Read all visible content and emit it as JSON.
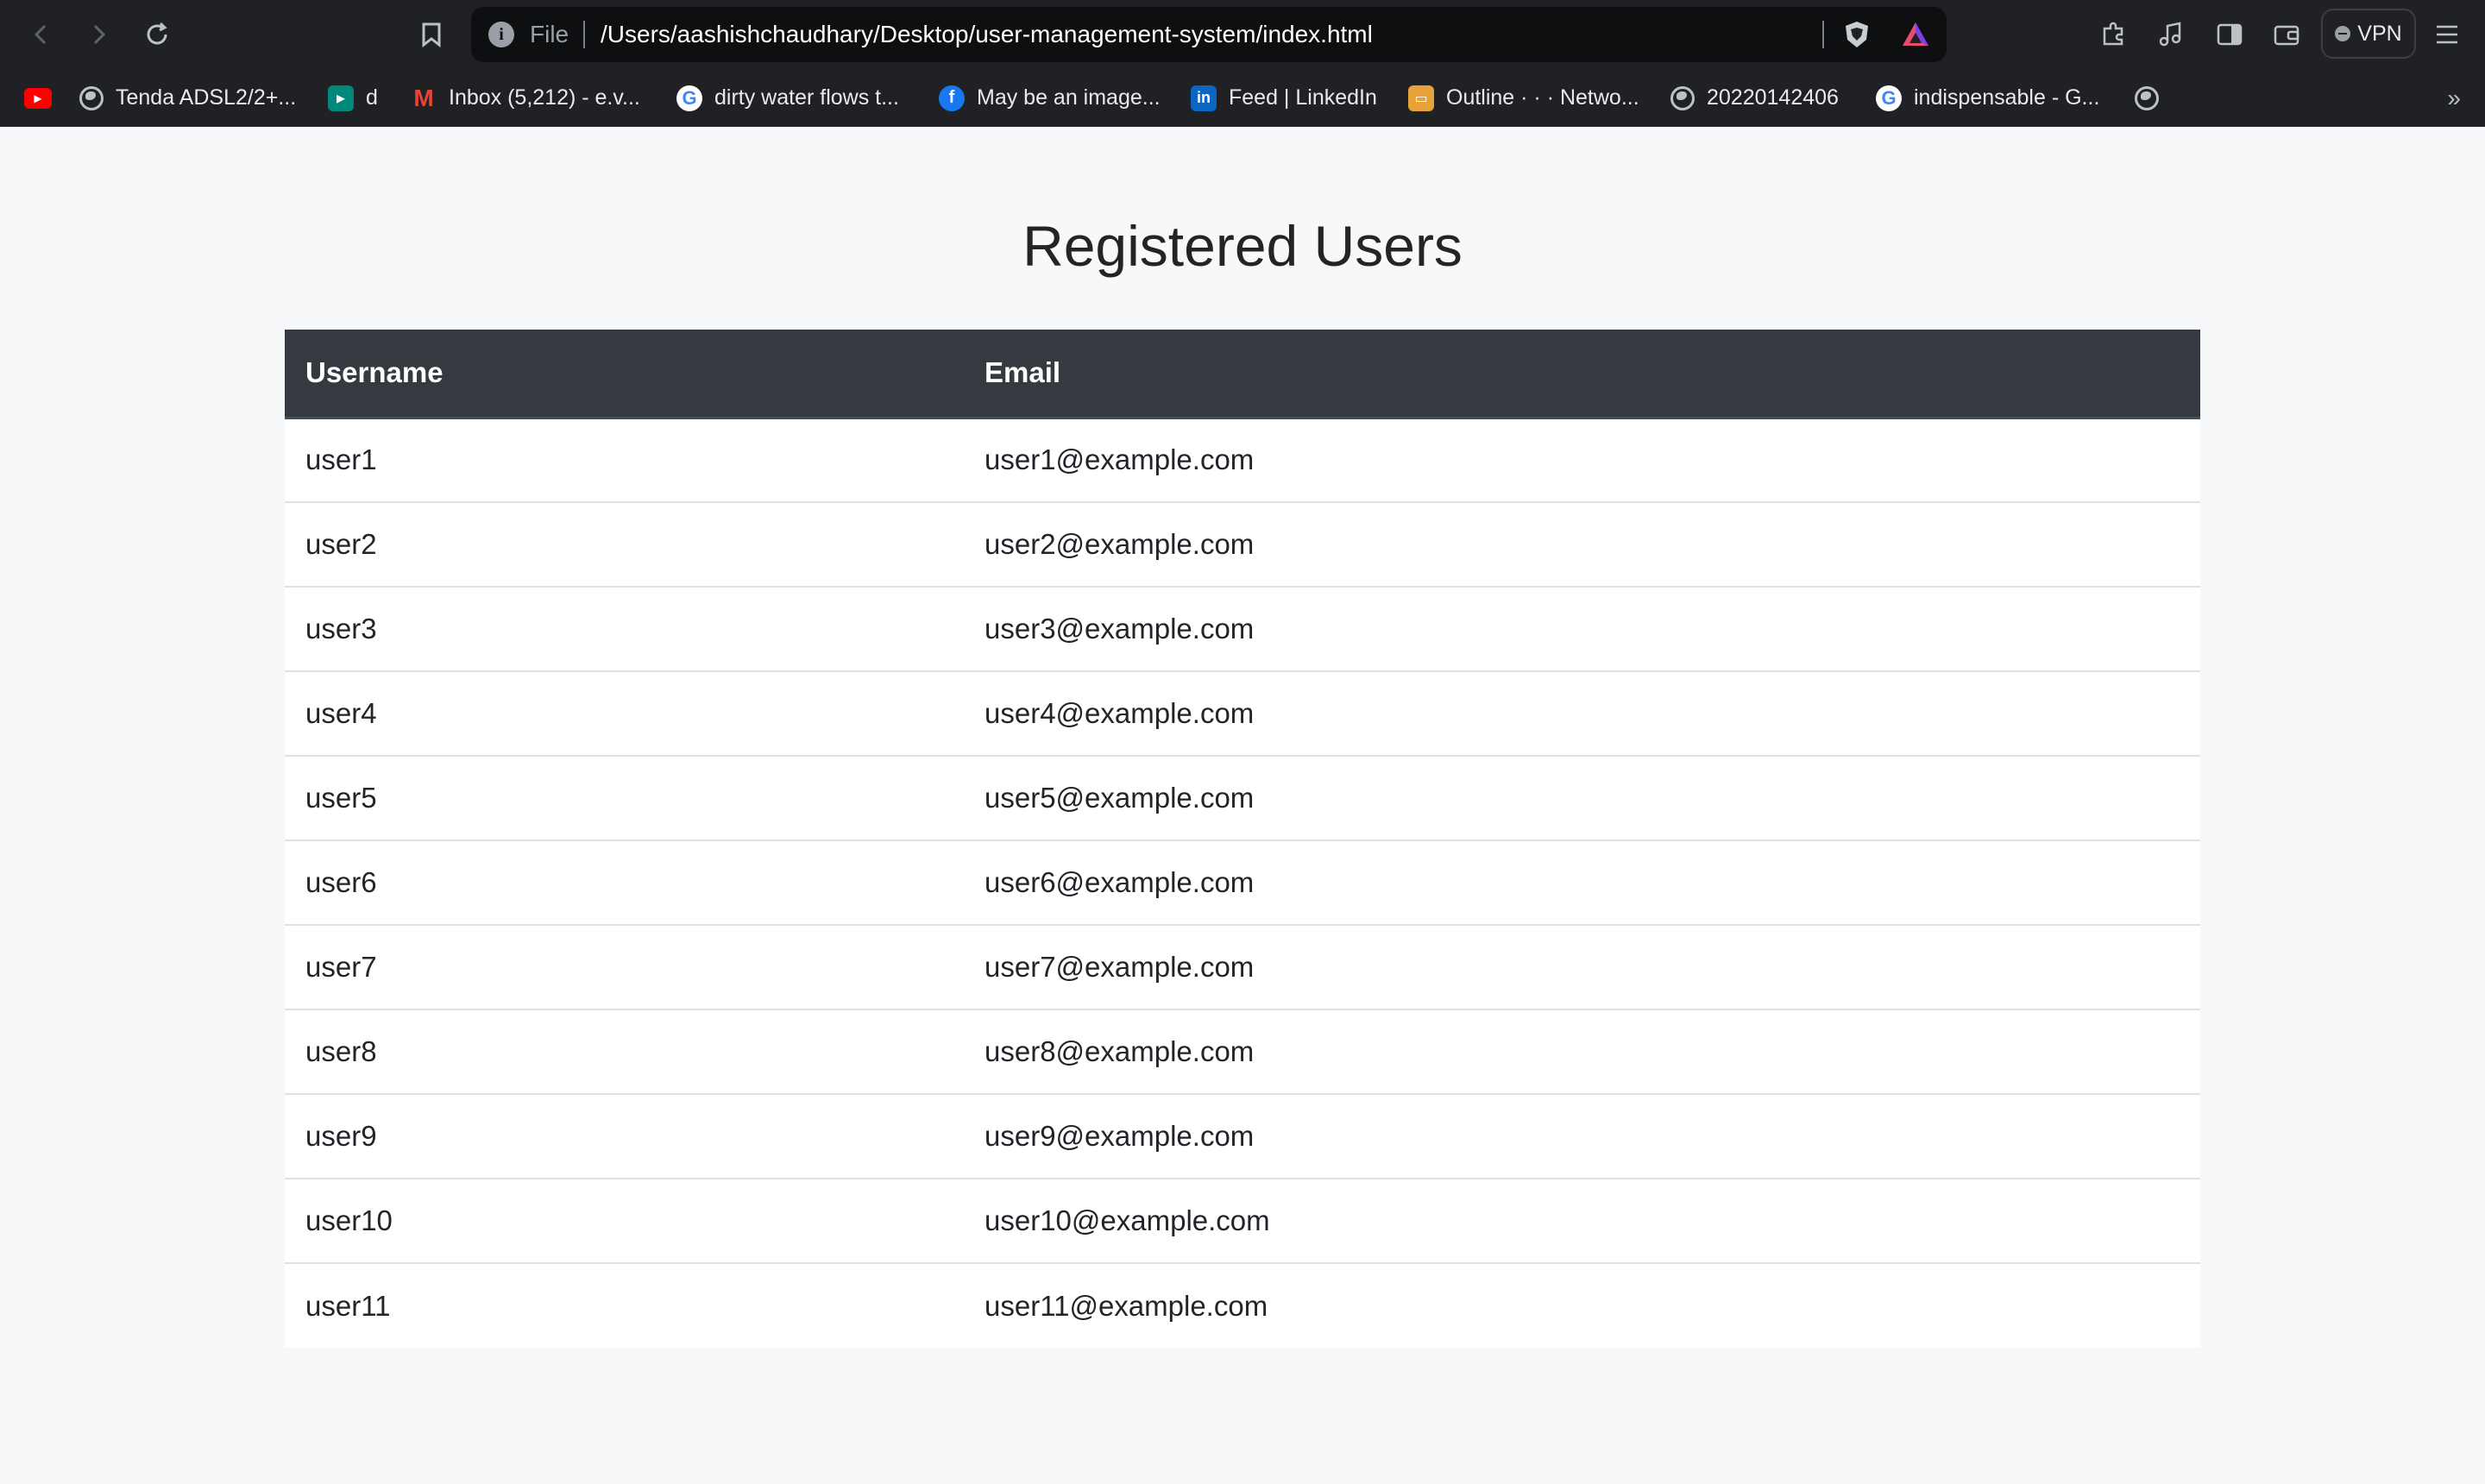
{
  "browser": {
    "address_scheme": "File",
    "address_path": "/Users/aashishchaudhary/Desktop/user-management-system/index.html",
    "vpn_label": "VPN",
    "bookmarks": [
      {
        "label": "",
        "icon": "youtube-icon"
      },
      {
        "label": "Tenda ADSL2/2+...",
        "icon": "globe-icon"
      },
      {
        "label": "d",
        "icon": "google-meet-icon"
      },
      {
        "label": "Inbox (5,212) - e.v...",
        "icon": "gmail-icon"
      },
      {
        "label": "dirty water flows t...",
        "icon": "google-icon"
      },
      {
        "label": "May be an image...",
        "icon": "facebook-icon"
      },
      {
        "label": "Feed | LinkedIn",
        "icon": "linkedin-icon"
      },
      {
        "label": "Outline · · · Netwo...",
        "icon": "slides-icon"
      },
      {
        "label": "20220142406",
        "icon": "globe-icon"
      },
      {
        "label": "indispensable - G...",
        "icon": "google-icon"
      },
      {
        "label": "",
        "icon": "globe-icon"
      }
    ],
    "more_bookmarks": "»"
  },
  "page": {
    "title": "Registered Users",
    "table": {
      "headers": {
        "username": "Username",
        "email": "Email"
      },
      "rows": [
        {
          "username": "user1",
          "email": "user1@example.com"
        },
        {
          "username": "user2",
          "email": "user2@example.com"
        },
        {
          "username": "user3",
          "email": "user3@example.com"
        },
        {
          "username": "user4",
          "email": "user4@example.com"
        },
        {
          "username": "user5",
          "email": "user5@example.com"
        },
        {
          "username": "user6",
          "email": "user6@example.com"
        },
        {
          "username": "user7",
          "email": "user7@example.com"
        },
        {
          "username": "user8",
          "email": "user8@example.com"
        },
        {
          "username": "user9",
          "email": "user9@example.com"
        },
        {
          "username": "user10",
          "email": "user10@example.com"
        },
        {
          "username": "user11",
          "email": "user11@example.com"
        }
      ]
    }
  },
  "colors": {
    "header_bg": "#343a40",
    "page_bg": "#f7f8f9",
    "chrome_bg": "#202124"
  }
}
